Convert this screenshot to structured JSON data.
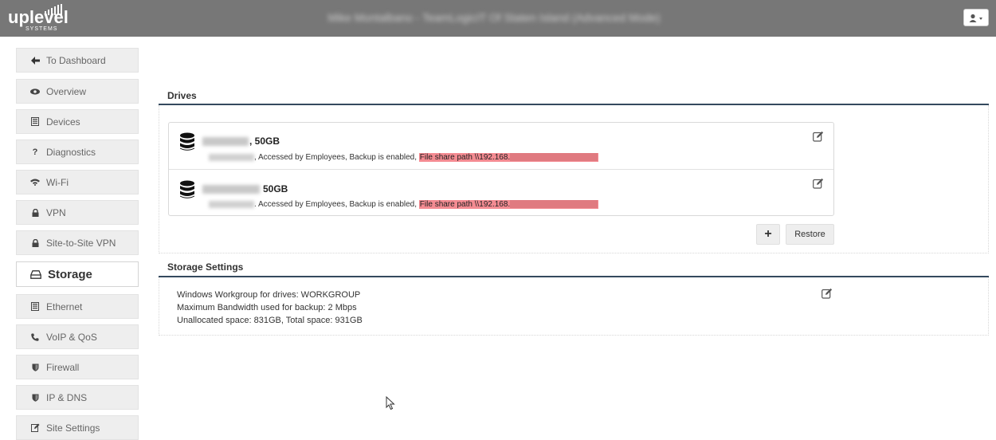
{
  "app": {
    "logo_text": "uplevel",
    "logo_sub": "SYSTEMS",
    "window_title": "Mike Montalbano - TeamLogicIT Of Staten Island (Advanced Mode)"
  },
  "sidebar": {
    "items": [
      {
        "label": "To Dashboard",
        "icon": "arrow-left-icon"
      },
      {
        "label": "Overview",
        "icon": "eye-icon"
      },
      {
        "label": "Devices",
        "icon": "devices-icon"
      },
      {
        "label": "Diagnostics",
        "icon": "question-icon"
      },
      {
        "label": "Wi-Fi",
        "icon": "wifi-icon"
      },
      {
        "label": "VPN",
        "icon": "lock-icon"
      },
      {
        "label": "Site-to-Site VPN",
        "icon": "lock-icon"
      },
      {
        "label": "Storage",
        "icon": "hdd-icon",
        "active": true
      },
      {
        "label": "Ethernet",
        "icon": "ethernet-icon"
      },
      {
        "label": "VoIP & QoS",
        "icon": "phone-icon"
      },
      {
        "label": "Firewall",
        "icon": "shield-icon"
      },
      {
        "label": "IP & DNS",
        "icon": "shield-icon"
      },
      {
        "label": "Site Settings",
        "icon": "edit-icon"
      }
    ]
  },
  "drives": {
    "title": "Drives",
    "items": [
      {
        "size": ", 50GB",
        "access_text": ", Accessed by Employees, Backup is enabled,",
        "share_path": "File share path \\\\192.168."
      },
      {
        "size": "50GB",
        "access_text": ". Accessed by Employees, Backup is enabled,",
        "share_path": "File share path \\\\192.168."
      }
    ],
    "add_button": "+",
    "restore_button": "Restore"
  },
  "storage_settings": {
    "title": "Storage Settings",
    "workgroup": "Windows Workgroup for drives: WORKGROUP",
    "bandwidth": "Maximum Bandwidth used for backup: 2 Mbps",
    "space": "Unallocated space: 831GB, Total space: 931GB"
  }
}
